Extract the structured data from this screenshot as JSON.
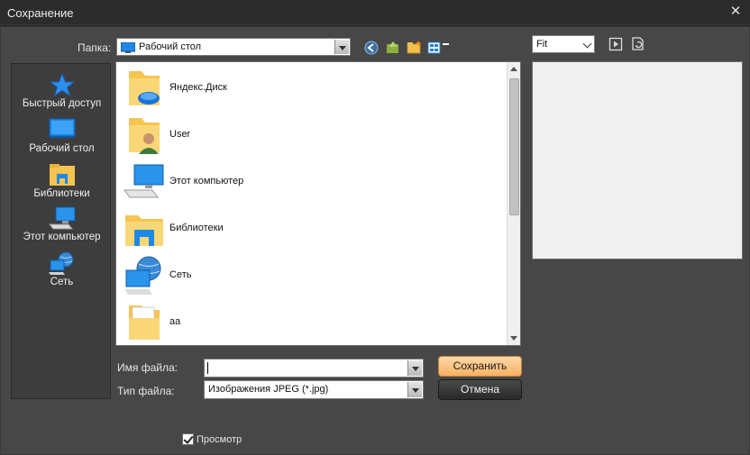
{
  "window": {
    "title": "Сохранение",
    "close_glyph": "✕"
  },
  "folder": {
    "label": "Папка:",
    "current": "Рабочий стол"
  },
  "places": [
    {
      "label": "Быстрый доступ",
      "icon": "star-icon"
    },
    {
      "label": "Рабочий стол",
      "icon": "desktop-icon"
    },
    {
      "label": "Библиотеки",
      "icon": "libraries-icon"
    },
    {
      "label": "Этот компьютер",
      "icon": "computer-icon"
    },
    {
      "label": "Сеть",
      "icon": "network-icon"
    }
  ],
  "files": [
    {
      "name": "Яндекс.Диск",
      "icon": "cloud-folder-icon"
    },
    {
      "name": "User",
      "icon": "user-folder-icon"
    },
    {
      "name": "Этот компьютер",
      "icon": "computer-icon"
    },
    {
      "name": "Библиотеки",
      "icon": "libraries-icon"
    },
    {
      "name": "Сеть",
      "icon": "network-icon"
    },
    {
      "name": "aa",
      "icon": "folder-icon"
    }
  ],
  "filename": {
    "label": "Имя файла:",
    "value": ""
  },
  "filetype": {
    "label": "Тип файла:",
    "value": "Изображения JPEG (*.jpg)"
  },
  "buttons": {
    "save": "Сохранить",
    "cancel": "Отмена"
  },
  "preview": {
    "zoom": "Fit",
    "checkbox_label": "Просмотр",
    "checked": true
  },
  "colors": {
    "primary_button": "#f6b164",
    "dialog_bg": "#474747",
    "accent_blue": "#1e7fd6"
  }
}
